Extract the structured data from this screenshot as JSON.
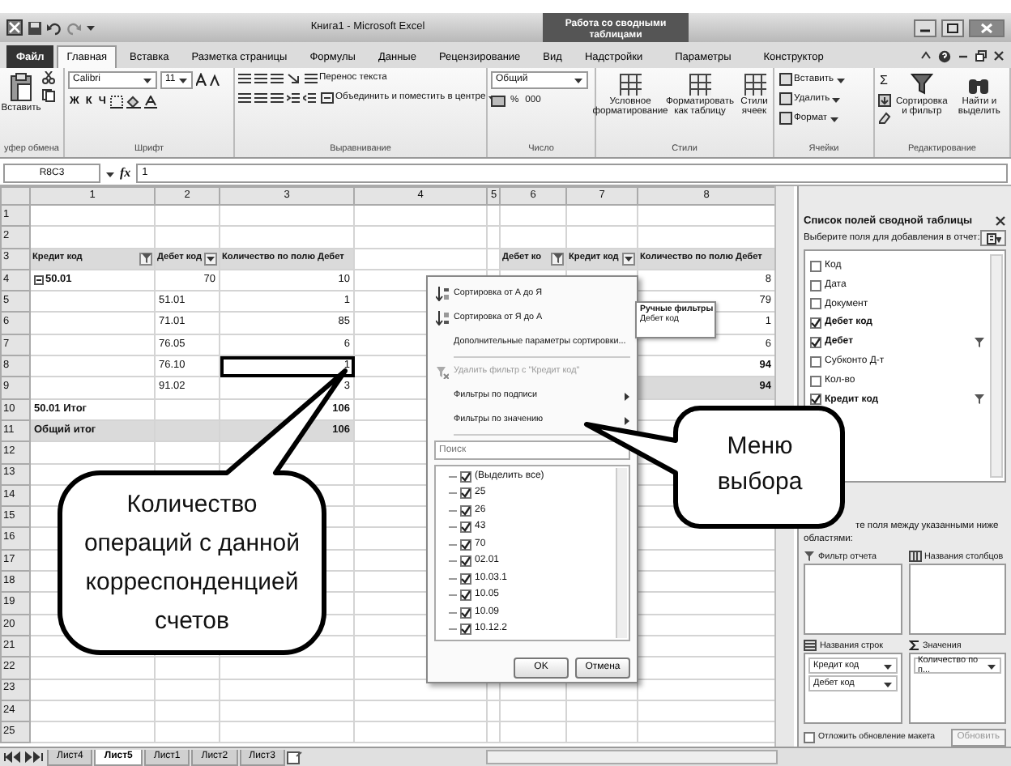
{
  "title_bar": {
    "title": "Книга1 - Microsoft Excel",
    "context_title": "Работа со сводными таблицами"
  },
  "ribbon_tabs": [
    {
      "label": "Файл",
      "kind": "file",
      "selected": false
    },
    {
      "label": "Главная",
      "kind": "tab",
      "selected": true
    },
    {
      "label": "Вставка",
      "kind": "tab",
      "selected": false
    },
    {
      "label": "Разметка страницы",
      "kind": "tab",
      "selected": false
    },
    {
      "label": "Формулы",
      "kind": "tab",
      "selected": false
    },
    {
      "label": "Данные",
      "kind": "tab",
      "selected": false
    },
    {
      "label": "Рецензирование",
      "kind": "tab",
      "selected": false
    },
    {
      "label": "Вид",
      "kind": "tab",
      "selected": false
    },
    {
      "label": "Надстройки",
      "kind": "tab",
      "selected": false
    },
    {
      "label": "Параметры",
      "kind": "context",
      "selected": false
    },
    {
      "label": "Конструктор",
      "kind": "context",
      "selected": false
    }
  ],
  "ribbon": {
    "clipboard": {
      "label": "уфер обмена",
      "paste": "Вставить"
    },
    "font": {
      "label": "Шрифт",
      "font_name": "Calibri",
      "font_size": "11",
      "style_buttons": [
        "Ж",
        "К",
        "Ч"
      ]
    },
    "alignment": {
      "label": "Выравнивание",
      "wrap": "Перенос текста",
      "merge": "Объединить и поместить в центре"
    },
    "number": {
      "label": "Число",
      "format": "Общий",
      "buttons": [
        "%",
        "000"
      ]
    },
    "styles": {
      "label": "Стили",
      "buttons": [
        "Условное форматирование",
        "Форматировать как таблицу",
        "Стили ячеек"
      ]
    },
    "cells": {
      "label": "Ячейки",
      "buttons": [
        "Вставить",
        "Удалить",
        "Формат"
      ]
    },
    "editing": {
      "label": "Редактирование",
      "autosum": "Σ",
      "buttons": [
        "Сортировка и фильтр",
        "Найти и выделить"
      ]
    }
  },
  "formula_bar": {
    "name_box": "R8C3",
    "fx": "fx",
    "value": "1"
  },
  "sheet": {
    "columns": [
      "1",
      "2",
      "3",
      "4",
      "5",
      "6",
      "7",
      "8"
    ],
    "rows": [
      {
        "num": "1"
      },
      {
        "num": "2"
      },
      {
        "num": "3",
        "cells": [
          {
            "text": "Кредит код",
            "kind": "header",
            "filtered": true,
            "selected": false
          },
          {
            "text": "Дебет код",
            "kind": "header",
            "filtered": false,
            "selected": false
          },
          {
            "text": "Количество по полю Дебет",
            "kind": "header",
            "selected": false
          },
          null,
          null,
          {
            "text": "Дебет ко",
            "kind": "header",
            "filtered": true,
            "selected": false
          },
          {
            "text": "Кредит код",
            "kind": "header",
            "filtered": false,
            "selected": false
          },
          {
            "text": "Количество по полю Дебет",
            "kind": "header",
            "selected": false
          }
        ]
      },
      {
        "num": "4",
        "cells": [
          {
            "text": "50.01",
            "kind": "group",
            "expanded": true,
            "selected": false
          },
          {
            "text": "70",
            "kind": "number",
            "selected": false
          },
          {
            "text": "10",
            "kind": "number",
            "selected": false
          },
          null,
          null,
          null,
          null,
          {
            "text": "8",
            "kind": "number",
            "selected": false
          }
        ]
      },
      {
        "num": "5",
        "cells": [
          null,
          {
            "text": "51.01",
            "kind": "text",
            "selected": false
          },
          {
            "text": "1",
            "kind": "number",
            "selected": false
          },
          null,
          null,
          null,
          null,
          {
            "text": "79",
            "kind": "number",
            "selected": false
          }
        ]
      },
      {
        "num": "6",
        "cells": [
          null,
          {
            "text": "71.01",
            "kind": "text",
            "selected": false
          },
          {
            "text": "85",
            "kind": "number",
            "selected": false
          },
          null,
          null,
          null,
          null,
          {
            "text": "1",
            "kind": "number",
            "selected": false
          }
        ]
      },
      {
        "num": "7",
        "cells": [
          null,
          {
            "text": "76.05",
            "kind": "text",
            "selected": false
          },
          {
            "text": "6",
            "kind": "number",
            "selected": false
          },
          null,
          null,
          null,
          null,
          {
            "text": "6",
            "kind": "number",
            "selected": false
          }
        ]
      },
      {
        "num": "8",
        "cells": [
          null,
          {
            "text": "76.10",
            "kind": "text",
            "selected": false
          },
          {
            "text": "1",
            "kind": "number",
            "selected": true
          },
          null,
          null,
          null,
          null,
          {
            "text": "94",
            "kind": "subtotal",
            "selected": false
          }
        ]
      },
      {
        "num": "9",
        "cells": [
          null,
          {
            "text": "91.02",
            "kind": "text",
            "selected": false
          },
          {
            "text": "3",
            "kind": "number",
            "selected": false
          },
          null,
          null,
          null,
          null,
          {
            "text": "94",
            "kind": "grandtotal",
            "selected": false
          }
        ]
      },
      {
        "num": "10",
        "cells": [
          {
            "text": "50.01 Итог",
            "kind": "subtotal",
            "selected": false
          },
          {
            "kind": "subtotal",
            "selected": false
          },
          {
            "text": "106",
            "kind": "subtotal",
            "selected": false
          }
        ]
      },
      {
        "num": "11",
        "cells": [
          {
            "text": "Общий итог",
            "kind": "grandtotal",
            "selected": false
          },
          {
            "kind": "grandtotal",
            "selected": false
          },
          {
            "text": "106",
            "kind": "grandtotal",
            "selected": false
          }
        ]
      },
      {
        "num": "12"
      },
      {
        "num": "13"
      },
      {
        "num": "14"
      },
      {
        "num": "15"
      },
      {
        "num": "16"
      },
      {
        "num": "17"
      },
      {
        "num": "18"
      },
      {
        "num": "19"
      },
      {
        "num": "20"
      },
      {
        "num": "21"
      },
      {
        "num": "22"
      },
      {
        "num": "23"
      },
      {
        "num": "24"
      },
      {
        "num": "25"
      }
    ]
  },
  "filter_menu": {
    "items": [
      {
        "label": "Сортировка от А до Я",
        "kind": "sort_asc",
        "disabled": false
      },
      {
        "label": "Сортировка от Я до А",
        "kind": "sort_desc",
        "disabled": false
      },
      {
        "label": "Дополнительные параметры сортировки...",
        "kind": "plain",
        "disabled": false
      },
      {
        "label": "Удалить фильтр с \"Кредит код\"",
        "kind": "clear_filter",
        "disabled": true
      },
      {
        "label": "Фильтры по подписи",
        "kind": "submenu",
        "disabled": false
      },
      {
        "label": "Фильтры по значению",
        "kind": "submenu",
        "disabled": false
      }
    ],
    "search": {
      "placeholder": "Поиск"
    },
    "values": [
      {
        "label": "(Выделить все)",
        "checked": true
      },
      {
        "label": "25",
        "checked": true
      },
      {
        "label": "26",
        "checked": true
      },
      {
        "label": "43",
        "checked": true
      },
      {
        "label": "70",
        "checked": true
      },
      {
        "label": "02.01",
        "checked": true
      },
      {
        "label": "10.03.1",
        "checked": true
      },
      {
        "label": "10.05",
        "checked": true
      },
      {
        "label": "10.09",
        "checked": true
      },
      {
        "label": "10.12.2",
        "checked": true
      }
    ],
    "buttons": [
      "OK",
      "Отмена"
    ]
  },
  "tooltip": {
    "title": "Ручные фильтры",
    "text": "Дебет код"
  },
  "field_list": {
    "title": "Список полей сводной таблицы",
    "prompt": "Выберите поля для добавления в отчет:",
    "fields": [
      {
        "label": "Код",
        "checked": false,
        "filtered": false
      },
      {
        "label": "Дата",
        "checked": false,
        "filtered": false
      },
      {
        "label": "Документ",
        "checked": false,
        "filtered": false
      },
      {
        "label": "Дебет код",
        "checked": true,
        "filtered": false
      },
      {
        "label": "Дебет",
        "checked": true,
        "filtered": true
      },
      {
        "label": "Субконто Д-т",
        "checked": false,
        "filtered": false
      },
      {
        "label": "Кол-во",
        "checked": false,
        "filtered": false
      },
      {
        "label": "Кредит код",
        "checked": true,
        "filtered": true
      }
    ],
    "areas_hint": "те поля между указанными ниже областями:",
    "areas": [
      {
        "title": "Фильтр отчета",
        "kind": "filter"
      },
      {
        "title": "Названия столбцов",
        "kind": "columns"
      },
      {
        "title": "Названия строк",
        "kind": "rows",
        "items": [
          "Кредит код",
          "Дебет код"
        ]
      },
      {
        "title": "Значения",
        "kind": "values",
        "items": [
          "Количество по п..."
        ]
      }
    ],
    "defer": {
      "label": "Отложить обновление макета",
      "checked": false
    },
    "update_button": {
      "label": "Обновить",
      "disabled": true
    }
  },
  "sheet_tabs": [
    {
      "label": "Лист4",
      "selected": false
    },
    {
      "label": "Лист5",
      "selected": true
    },
    {
      "label": "Лист1",
      "selected": false
    },
    {
      "label": "Лист2",
      "selected": false
    },
    {
      "label": "Лист3",
      "selected": false
    }
  ],
  "callouts": [
    {
      "text": "Количество операций с данной корреспонденцией счетов",
      "kind": "cell"
    },
    {
      "text": "Меню выбора",
      "kind": "menu"
    }
  ]
}
